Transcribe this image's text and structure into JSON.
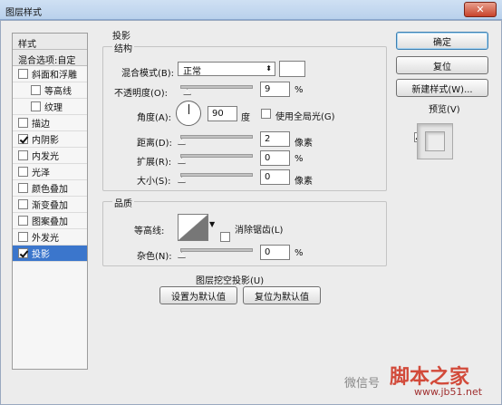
{
  "window": {
    "title": "图层样式",
    "close_label": "✕"
  },
  "styles_panel": {
    "header": "样式",
    "blend_options": "混合选项:自定",
    "items": [
      {
        "label": "斜面和浮雕",
        "checked": false,
        "sub": false
      },
      {
        "label": "等高线",
        "checked": false,
        "sub": true
      },
      {
        "label": "纹理",
        "checked": false,
        "sub": true
      },
      {
        "label": "描边",
        "checked": false,
        "sub": false
      },
      {
        "label": "内阴影",
        "checked": true,
        "sub": false
      },
      {
        "label": "内发光",
        "checked": false,
        "sub": false
      },
      {
        "label": "光泽",
        "checked": false,
        "sub": false
      },
      {
        "label": "颜色叠加",
        "checked": false,
        "sub": false
      },
      {
        "label": "渐变叠加",
        "checked": false,
        "sub": false
      },
      {
        "label": "图案叠加",
        "checked": false,
        "sub": false
      },
      {
        "label": "外发光",
        "checked": false,
        "sub": false
      },
      {
        "label": "投影",
        "checked": true,
        "sub": false,
        "selected": true
      }
    ]
  },
  "drop_shadow": {
    "title": "投影",
    "structure": {
      "title": "结构",
      "blend_mode_label": "混合模式(B):",
      "blend_mode_value": "正常",
      "opacity_label": "不透明度(O):",
      "opacity_value": "9",
      "opacity_unit": "%",
      "opacity_level": 0.09,
      "angle_label": "角度(A):",
      "angle_value": "90",
      "angle_unit": "度",
      "global_light_label": "使用全局光(G)",
      "global_light_checked": false,
      "distance_label": "距离(D):",
      "distance_value": "2",
      "distance_unit": "像素",
      "spread_label": "扩展(R):",
      "spread_value": "0",
      "spread_unit": "%",
      "size_label": "大小(S):",
      "size_value": "0",
      "size_unit": "像素"
    },
    "quality": {
      "title": "品质",
      "contour_label": "等高线:",
      "antialias_label": "消除锯齿(L)",
      "antialias_checked": false,
      "noise_label": "杂色(N):",
      "noise_value": "0",
      "noise_unit": "%"
    },
    "knockout_label": "图层挖空投影(U)",
    "knockout_checked": true,
    "make_default": "设置为默认值",
    "reset_default": "复位为默认值"
  },
  "buttons": {
    "ok": "确定",
    "reset": "复位",
    "new_style": "新建样式(W)...",
    "preview_label": "预览(V)",
    "preview_checked": true
  },
  "watermark": {
    "wechat": "微信号",
    "site": "脚本之家",
    "url": "www.jb51.net"
  }
}
